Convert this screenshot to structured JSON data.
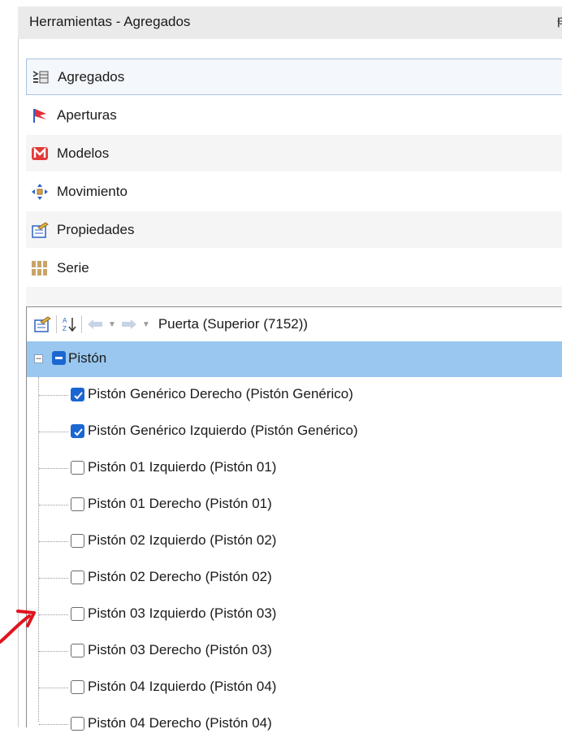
{
  "window": {
    "title": "Herramientas - Agregados",
    "pin_glyph": "ᵽ"
  },
  "tools": [
    {
      "label": "Agregados",
      "icon": "agregados-icon",
      "selected": true
    },
    {
      "label": "Aperturas",
      "icon": "aperturas-flag-icon"
    },
    {
      "label": "Modelos",
      "icon": "modelos-m-icon"
    },
    {
      "label": "Movimiento",
      "icon": "movimiento-arrows-icon"
    },
    {
      "label": "Propiedades",
      "icon": "propiedades-icon"
    },
    {
      "label": "Serie",
      "icon": "serie-grid-icon"
    }
  ],
  "toolbar": {
    "path": "Puerta (Superior (7152))",
    "sort_icon": "sort-az-icon",
    "back_icon": "back-arrow-icon",
    "forward_icon": "forward-arrow-icon"
  },
  "tree": {
    "root": {
      "label": "Pistón",
      "expanded": true
    },
    "items": [
      {
        "label": "Pistón Genérico Derecho (Pistón Genérico)",
        "checked": true
      },
      {
        "label": "Pistón Genérico Izquierdo (Pistón Genérico)",
        "checked": true
      },
      {
        "label": "Pistón 01 Izquierdo  (Pistón 01)",
        "checked": false
      },
      {
        "label": "Pistón 01 Derecho  (Pistón 01)",
        "checked": false
      },
      {
        "label": "Pistón 02 Izquierdo  (Pistón 02)",
        "checked": false
      },
      {
        "label": "Pistón 02 Derecho  (Pistón 02)",
        "checked": false
      },
      {
        "label": "Pistón 03 Izquierdo  (Pistón 03)",
        "checked": false
      },
      {
        "label": "Pistón 03 Derecho  (Pistón 03)",
        "checked": false
      },
      {
        "label": "Pistón 04 Izquierdo  (Pistón 04)",
        "checked": false
      },
      {
        "label": "Pistón 04 Derecho  (Pistón 04)",
        "checked": false
      }
    ]
  },
  "colors": {
    "selection": "#99c7ef",
    "checkbox_checked": "#1c66d2",
    "annotation_arrow": "#e0141e"
  }
}
